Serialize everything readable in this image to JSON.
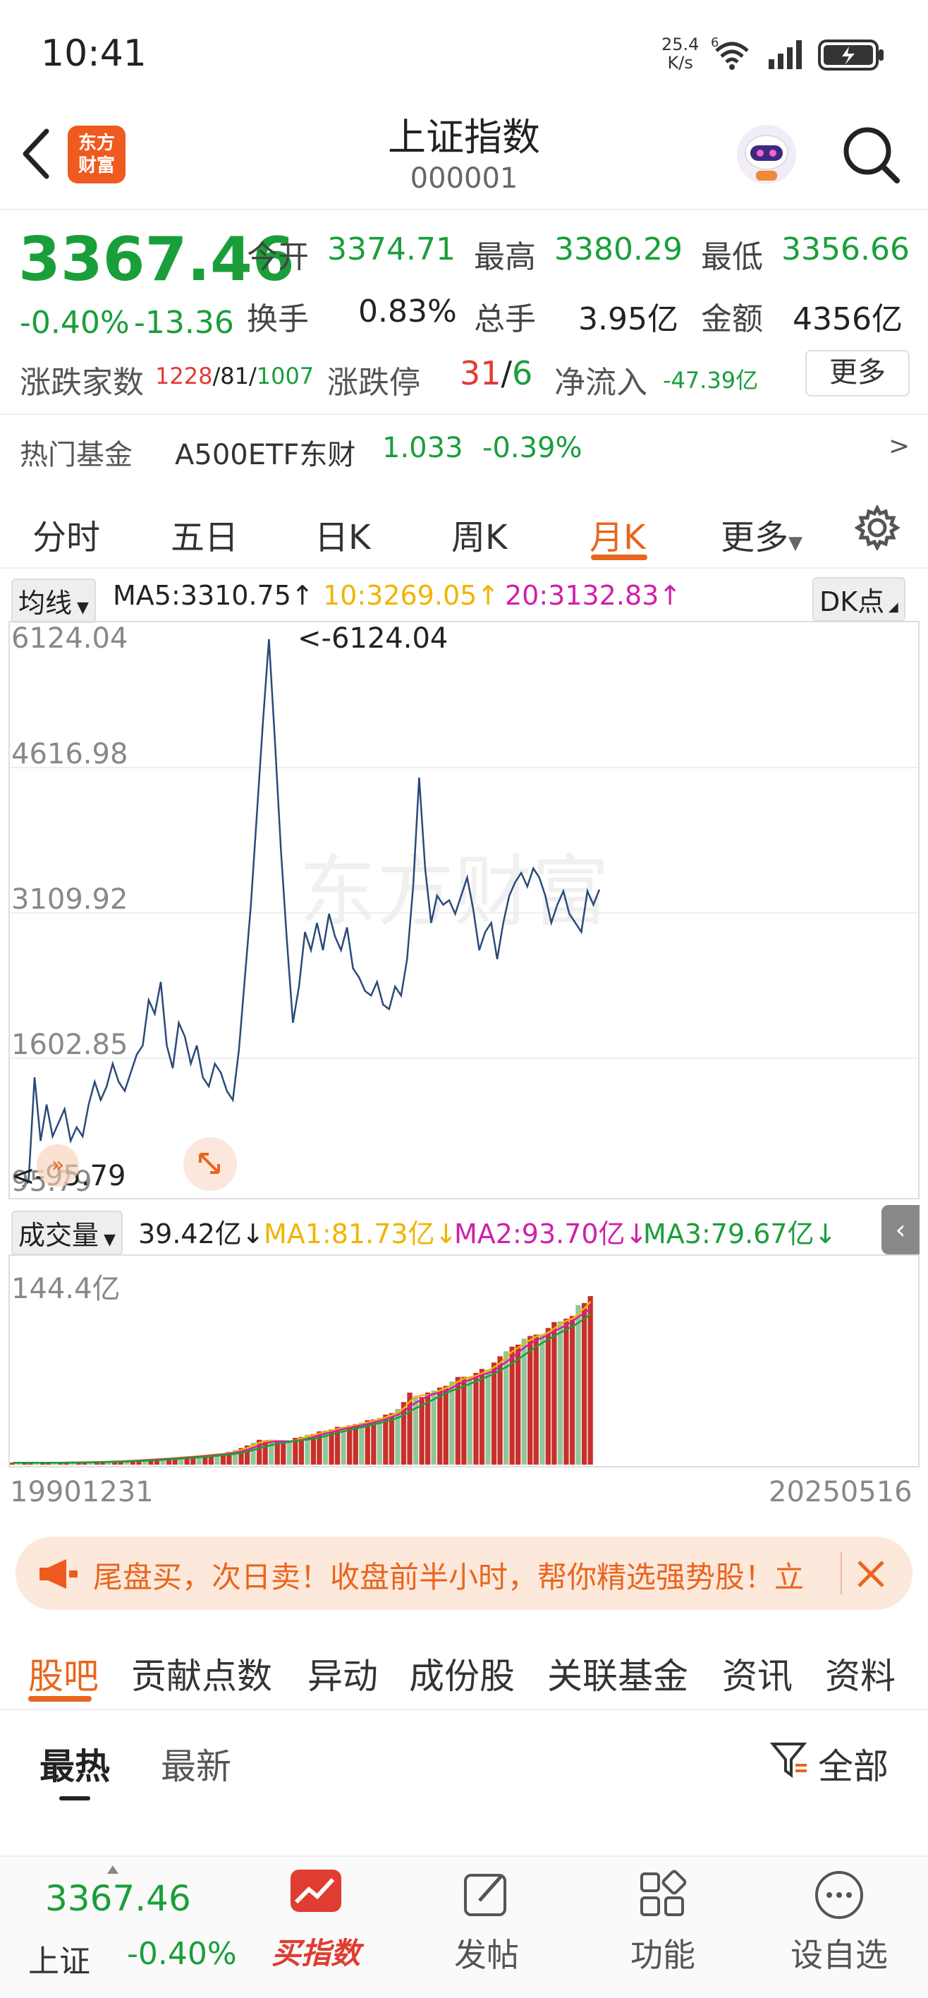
{
  "status": {
    "time": "10:41",
    "net_speed_top": "25.4",
    "net_speed_unit": "K/s",
    "net_type": "6"
  },
  "header": {
    "title": "上证指数",
    "code": "000001",
    "logo_line1": "东方",
    "logo_line2": "财富"
  },
  "quote": {
    "price": "3367.46",
    "change_pct": "-0.40%",
    "change": "-13.36",
    "open_label": "今开",
    "open": "3374.71",
    "high_label": "最高",
    "high": "3380.29",
    "low_label": "最低",
    "low": "3356.66",
    "turnover_label": "换手",
    "turnover": "0.83%",
    "hands_label": "总手",
    "hands": "3.95亿",
    "amount_label": "金额",
    "amount": "4356亿",
    "breadth_label": "涨跌家数",
    "breadth_up": "1228",
    "breadth_sep1": "/",
    "breadth_flat": "81",
    "breadth_sep2": "/",
    "breadth_down": "1007",
    "limit_label": "涨跌停",
    "limit_up": "31",
    "limit_sep": "/",
    "limit_down": "6",
    "netflow_label": "净流入",
    "netflow": "-47.39亿",
    "more_button": "更多"
  },
  "hot_fund": {
    "label": "热门基金",
    "name": "A500ETF东财",
    "price": "1.033",
    "change": "-0.39%",
    "arrow": ">"
  },
  "chart_tabs": [
    "分时",
    "五日",
    "日K",
    "周K",
    "月K",
    "更多"
  ],
  "active_chart_tab": "月K",
  "ma_row": {
    "selector": "均线",
    "ma5": "MA5:3310.75↑",
    "ma10": "10:3269.05↑",
    "ma20": "20:3132.83↑",
    "dk_button": "DK点"
  },
  "price_axis": [
    "6124.04",
    "4616.98",
    "3109.92",
    "1602.85",
    "95.79"
  ],
  "max_marker": "<-6124.04",
  "min_marker": "<-95.79",
  "watermark": "东方财富",
  "volume_row": {
    "selector": "成交量",
    "current": "39.42亿↓",
    "ma1": "MA1:81.73亿↓",
    "ma2": "MA2:93.70亿↓",
    "ma3": "MA3:79.67亿↓"
  },
  "volume_axis_top": "144.4亿",
  "date_start": "19901231",
  "date_end": "20250516",
  "colors": {
    "accent": "#e8661d",
    "down": "#1a9e3a",
    "up": "#e03c31",
    "line": "#2b4a7a",
    "ma_yellow": "#f0b400",
    "ma_pink": "#d020a8",
    "ma_green": "#1a9e3a"
  },
  "chart_data": {
    "type": "line",
    "x_range": [
      "19901231",
      "20250516"
    ],
    "ylim": [
      95.79,
      6124.04
    ],
    "series": [
      {
        "values": [
          96,
          150,
          1300,
          600,
          1000,
          650,
          800,
          950,
          600,
          750,
          650,
          1000,
          1250,
          1050,
          1200,
          1450,
          1250,
          1150,
          1350,
          1550,
          1650,
          2150,
          2000,
          2350,
          1650,
          1400,
          1900,
          1750,
          1450,
          1650,
          1300,
          1200,
          1450,
          1350,
          1150,
          1050,
          1600,
          2400,
          3200,
          4200,
          5200,
          6124,
          5000,
          3800,
          2800,
          1900,
          2300,
          2900,
          2700,
          3000,
          2700,
          3100,
          2850,
          2700,
          2950,
          2500,
          2400,
          2250,
          2200,
          2350,
          2100,
          2050,
          2300,
          2200,
          2600,
          3400,
          4600,
          3600,
          3000,
          3300,
          3200,
          3250,
          3100,
          3300,
          3500,
          3150,
          2700,
          2900,
          3000,
          2600,
          3000,
          3300,
          3450,
          3550,
          3400,
          3600,
          3500,
          3300,
          3000,
          3200,
          3350,
          3100,
          3000,
          2900,
          3350,
          3200,
          3367
        ]
      }
    ]
  }
}
